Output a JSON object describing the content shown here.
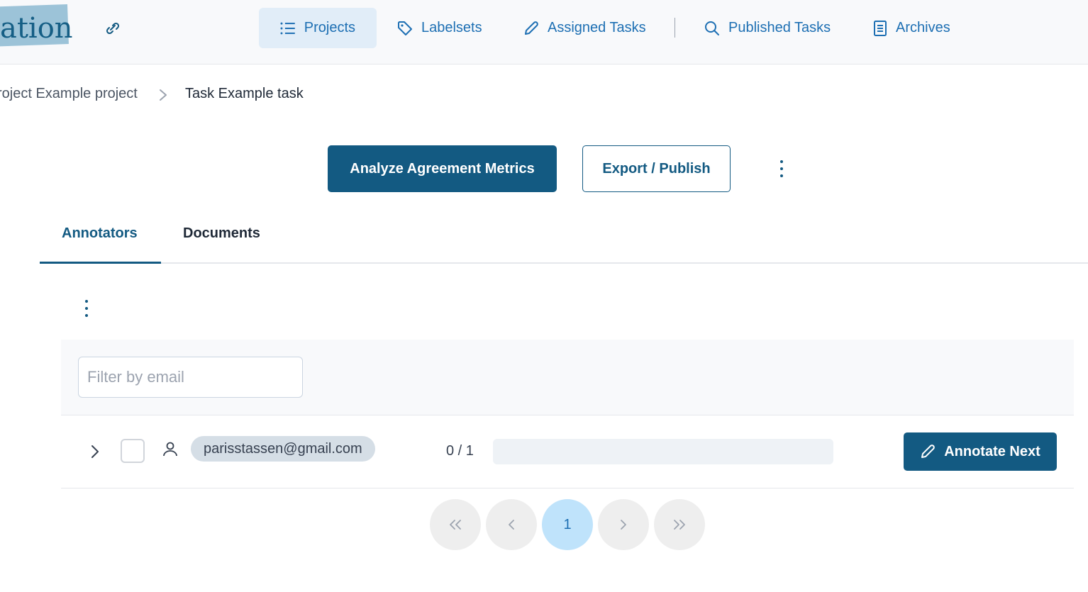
{
  "brand": {
    "logo_text": "ation"
  },
  "nav": {
    "items": [
      {
        "label": "Projects",
        "icon": "list-icon",
        "active": true
      },
      {
        "label": "Labelsets",
        "icon": "tag-icon"
      },
      {
        "label": "Assigned Tasks",
        "icon": "pencil-icon"
      },
      {
        "label": "Published Tasks",
        "icon": "search-icon"
      },
      {
        "label": "Archives",
        "icon": "archive-icon"
      }
    ]
  },
  "breadcrumb": {
    "project": "roject Example project",
    "task": "Task Example task"
  },
  "actions": {
    "analyze_label": "Analyze Agreement Metrics",
    "export_label": "Export / Publish"
  },
  "tabs": [
    {
      "label": "Annotators",
      "active": true
    },
    {
      "label": "Documents"
    }
  ],
  "filter": {
    "placeholder": "Filter by email",
    "value": ""
  },
  "annotators": [
    {
      "email": "parisstassen@gmail.com",
      "progress_text": "0 / 1",
      "progress_fraction": 0,
      "action_label": "Annotate Next"
    }
  ],
  "pagination": {
    "first": "«",
    "prev": "‹",
    "current": "1",
    "next": "›",
    "last": "»"
  },
  "colors": {
    "primary": "#135a82",
    "nav_link": "#1d6fb3",
    "active_nav_bg": "#e1edf8",
    "current_page": "#bfe3fb"
  }
}
